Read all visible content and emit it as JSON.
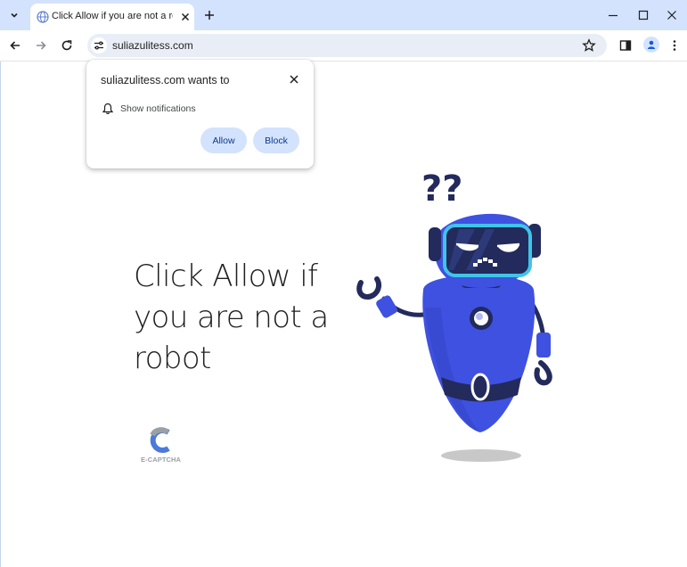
{
  "browser": {
    "tab": {
      "title": "Click Allow if you are not a robot"
    },
    "address_bar": {
      "url": "suliazulitess.com"
    }
  },
  "permission_popup": {
    "title": "suliazulitess.com wants to",
    "permission": "Show notifications",
    "allow_label": "Allow",
    "block_label": "Block"
  },
  "page": {
    "headline": "Click Allow if you are not a robot",
    "logo_text": "E-CAPTCHA",
    "question_marks": "??"
  },
  "icons": {
    "tab_search": "chevron-down-icon",
    "favicon": "globe-icon",
    "close": "close-icon",
    "new_tab": "plus-icon",
    "back": "back-arrow-icon",
    "forward": "forward-arrow-icon",
    "reload": "reload-icon",
    "site_info": "tune-icon",
    "bookmark": "star-icon",
    "side_panel": "side-panel-icon",
    "profile": "profile-icon",
    "menu": "kebab-menu-icon",
    "bell": "bell-icon"
  },
  "colors": {
    "tabstrip": "#d3e3fd",
    "omnibox": "#e9eef6",
    "button_fill": "#d3e3fd",
    "robot_blue": "#3f51e0",
    "robot_dark": "#232a5c",
    "visor_cyan": "#40c4e8"
  }
}
